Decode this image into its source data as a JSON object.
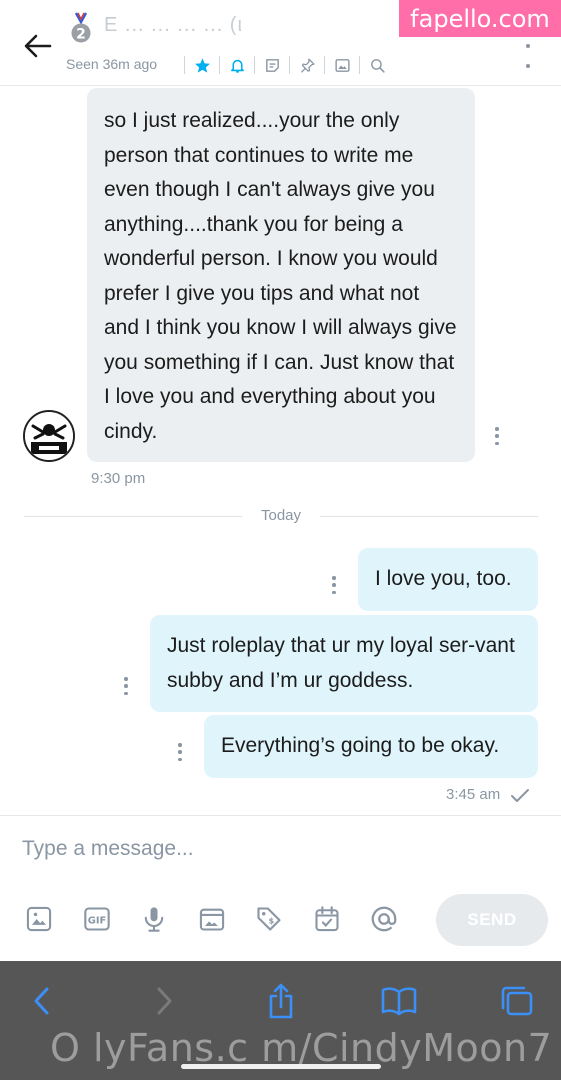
{
  "header": {
    "title": "E   ...  ...  ...  ...  (ι",
    "seen_text": "Seen 36m ago",
    "icons": [
      "star-icon",
      "bell-icon",
      "note-icon",
      "pin-icon",
      "gallery-icon",
      "search-icon"
    ],
    "accent_color": "#00aff0"
  },
  "watermark_top": "fapello.com",
  "messages": {
    "incoming": {
      "text": "so I just realized....your the only person that continues to write me even though I can't always give you anything....thank you for being a wonderful person. I know you would prefer I give you tips and what not and I think you know I will always give you something if I can. Just know that I love you and everything about you cindy.",
      "time": "9:30 pm"
    },
    "day_divider": "Today",
    "outgoing": [
      {
        "text": "I love you, too."
      },
      {
        "text": "Just roleplay that ur my loyal ser-vant subby and I’m ur goddess."
      },
      {
        "text": "Everything’s going to be okay."
      }
    ],
    "outgoing_time": "3:45 am"
  },
  "composer": {
    "placeholder": "Type a message...",
    "send_label": "SEND",
    "tools": [
      "image-icon",
      "gif-icon",
      "microphone-icon",
      "media-vault-icon",
      "price-tag-icon",
      "schedule-icon",
      "mention-icon"
    ]
  },
  "browser": {
    "buttons": [
      "back-icon",
      "forward-icon",
      "share-icon",
      "bookmarks-icon",
      "tabs-icon"
    ]
  },
  "watermark_bottom": "O lyFans.c m/CindyMoon7"
}
